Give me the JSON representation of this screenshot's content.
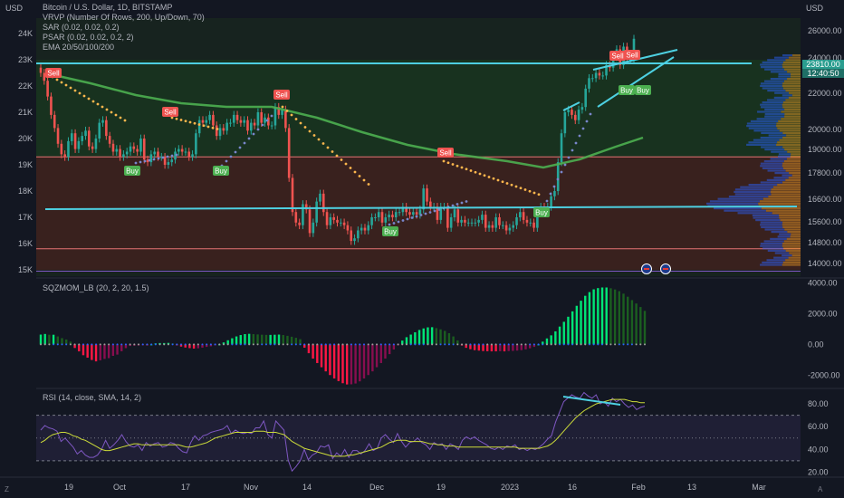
{
  "header": {
    "currency": "USD",
    "title": "Bitcoin / U.S. Dollar, 1D, BITSTAMP",
    "indicators": [
      "VRVP (Number Of Rows, 200, Up/Down, 70)",
      "SAR (0.02, 0.02, 0.2)",
      "PSAR (0.02, 0.02, 0.2, 2)",
      "EMA 20/50/100/200"
    ],
    "price_badge": "23810.00",
    "countdown": "12:40:50",
    "timezone_icon": "Z",
    "settings_icon": "A"
  },
  "colors": {
    "background": "#131722",
    "cyan_line": "#4dd0e1",
    "red_zone": "#b71c1c",
    "green_zone": "#1b5e20",
    "up": "#26a69a",
    "down": "#ef5350",
    "ema": "#4caf50",
    "sar_red": "#ffb74d",
    "sar_blue": "#7986cb",
    "sell_badge": "#ef5350",
    "buy_badge": "#4caf50",
    "rsi": "#7e57c2",
    "rsi_sma": "#cddc39"
  },
  "chart_data": [
    {
      "type": "candlestick",
      "title": "Bitcoin / U.S. Dollar, 1D, BITSTAMP",
      "ylabel_left": "USD",
      "yticks_left": [
        "24K",
        "23K",
        "22K",
        "21K",
        "20K",
        "19K",
        "18K",
        "17K",
        "16K",
        "15K"
      ],
      "yticks_right": [
        "26000.00",
        "24000.00",
        "22000.00",
        "20000.00",
        "19000.00",
        "17800.00",
        "16600.00",
        "15600.00",
        "14800.00",
        "14000.00"
      ],
      "xticks": [
        "19",
        "Oct",
        "17",
        "Nov",
        "14",
        "Dec",
        "19",
        "2023",
        "16",
        "Feb",
        "13",
        "Mar"
      ],
      "close_series": [
        22500,
        22200,
        21600,
        20900,
        20400,
        19800,
        19400,
        19300,
        19900,
        20200,
        19600,
        19900,
        20100,
        20300,
        19700,
        19600,
        20000,
        20600,
        20700,
        20100,
        19800,
        19500,
        19600,
        19300,
        19400,
        19500,
        19700,
        19600,
        19500,
        20000,
        19200,
        19100,
        19400,
        19500,
        19300,
        19300,
        19000,
        19100,
        19200,
        19500,
        19600,
        19500,
        19500,
        19300,
        19400,
        20200,
        20700,
        20600,
        20700,
        20900,
        20500,
        20100,
        20400,
        20300,
        20600,
        20600,
        20900,
        20700,
        20600,
        20700,
        20300,
        20600,
        20500,
        21000,
        20600,
        20800,
        20500,
        20500,
        21200,
        20900,
        21100,
        20400,
        18500,
        17200,
        16800,
        16700,
        17500,
        17300,
        16400,
        16800,
        17600,
        17900,
        17200,
        16700,
        17000,
        16900,
        16800,
        16800,
        16700,
        16500,
        16100,
        16200,
        16500,
        16600,
        16500,
        16700,
        17000,
        17000,
        17200,
        16800,
        17000,
        17100,
        17000,
        17200,
        17200,
        17400,
        17200,
        17100,
        17200,
        17100,
        17300,
        18100,
        17600,
        17400,
        17400,
        16900,
        17400,
        17400,
        16600,
        17000,
        17300,
        16800,
        16900,
        16800,
        16800,
        16800,
        16800,
        16900,
        17100,
        16600,
        16700,
        16600,
        17000,
        16700,
        16700,
        16500,
        16600,
        16700,
        17000,
        17200,
        16900,
        16800,
        16800,
        16600,
        17200,
        17400,
        17300,
        17400,
        17800,
        18000,
        19100,
        20200,
        21000,
        21100,
        20900,
        20700,
        21100,
        21200,
        21900,
        22300,
        22300,
        22500,
        22400,
        22400,
        22800,
        22700,
        23100,
        23400,
        22800,
        23500,
        23000,
        23000,
        23800
      ]
    },
    {
      "type": "bar",
      "title": "SQZMOM_LB (20, 2, 20, 1.5)",
      "yticks": [
        "4000.00",
        "2000.00",
        "0.00",
        "-2000.00"
      ],
      "values": [
        640,
        680,
        630,
        630,
        520,
        410,
        320,
        180,
        -230,
        -450,
        -700,
        -860,
        -1010,
        -1100,
        -1030,
        -940,
        -890,
        -740,
        -660,
        -440,
        -240,
        -100,
        -80,
        -70,
        -40,
        -50,
        0,
        70,
        90,
        90,
        100,
        70,
        -50,
        -140,
        -200,
        -240,
        -270,
        -250,
        -210,
        -160,
        -120,
        -60,
        0,
        130,
        270,
        400,
        520,
        610,
        670,
        690,
        670,
        650,
        630,
        620,
        620,
        630,
        640,
        610,
        560,
        500,
        430,
        340,
        -210,
        -570,
        -920,
        -1210,
        -1480,
        -1750,
        -1990,
        -2210,
        -2380,
        -2520,
        -2600,
        -2590,
        -2540,
        -2400,
        -2210,
        -1990,
        -1750,
        -1480,
        -1210,
        -920,
        -630,
        -330,
        -30,
        250,
        470,
        640,
        790,
        940,
        1040,
        1110,
        1120,
        1060,
        980,
        880,
        730,
        520,
        260,
        -70,
        -220,
        -310,
        -370,
        -400,
        -430,
        -440,
        -450,
        -450,
        -440,
        -450,
        -430,
        -420,
        -400,
        -370,
        -320,
        -250,
        -160,
        0,
        180,
        390,
        590,
        850,
        1160,
        1470,
        1800,
        2150,
        2510,
        2840,
        3160,
        3400,
        3580,
        3660,
        3700,
        3700,
        3650,
        3570,
        3460,
        3300,
        3100,
        2880,
        2660,
        2430,
        2180
      ],
      "ylim": [
        -2800,
        4200
      ]
    },
    {
      "type": "line",
      "title": "RSI (14, close, SMA, 14, 2)",
      "yticks": [
        "80.00",
        "60.00",
        "40.00",
        "20.00"
      ],
      "series": [
        {
          "name": "RSI",
          "values": [
            57,
            61,
            59,
            58,
            56,
            47,
            50,
            46,
            42,
            36,
            39,
            35,
            33,
            33,
            35,
            40,
            48,
            41,
            44,
            48,
            53,
            47,
            43,
            42,
            44,
            39,
            46,
            43,
            45,
            46,
            42,
            43,
            46,
            45,
            41,
            38,
            37,
            46,
            52,
            48,
            52,
            53,
            55,
            56,
            57,
            58,
            61,
            54,
            57,
            55,
            54,
            55,
            54,
            59,
            59,
            65,
            53,
            50,
            65,
            61,
            57,
            31,
            21,
            25,
            30,
            40,
            31,
            35,
            37,
            43,
            42,
            44,
            32,
            37,
            34,
            40,
            33,
            39,
            39,
            36,
            39,
            45,
            39,
            41,
            50,
            53,
            49,
            46,
            54,
            47,
            42,
            46,
            47,
            50,
            46,
            44,
            40,
            46,
            44,
            45,
            40,
            45,
            43,
            40,
            48,
            51,
            49,
            51,
            48,
            46,
            44,
            41,
            40,
            42,
            40,
            43,
            42,
            44,
            40,
            41,
            39,
            41,
            40,
            42,
            45,
            49,
            52,
            64,
            73,
            82,
            85,
            88,
            86,
            85,
            90,
            87,
            85,
            88,
            80,
            82,
            78,
            85,
            82,
            84,
            80,
            77,
            79,
            75,
            77,
            78
          ]
        },
        {
          "name": "SMA",
          "values": [
            46,
            48,
            51,
            53,
            54,
            55,
            55,
            54,
            52,
            51,
            49,
            48,
            46,
            44,
            42,
            40,
            39,
            39,
            40,
            41,
            42,
            43,
            44,
            45,
            45,
            44,
            44,
            44,
            44,
            44,
            44,
            44,
            44,
            44,
            44,
            43,
            42,
            42,
            43,
            44,
            45,
            46,
            48,
            50,
            51,
            52,
            53,
            54,
            55,
            55,
            55,
            55,
            55,
            56,
            56,
            56,
            55,
            55,
            55,
            54,
            53,
            50,
            47,
            45,
            43,
            41,
            40,
            39,
            38,
            37,
            36,
            35,
            34,
            34,
            34,
            34,
            35,
            35,
            36,
            37,
            38,
            39,
            40,
            41,
            42,
            44,
            46,
            47,
            48,
            48,
            48,
            47,
            47,
            47,
            47,
            46,
            45,
            45,
            44,
            44,
            43,
            43,
            43,
            42,
            42,
            42,
            42,
            42,
            42,
            42,
            42,
            42,
            42,
            42,
            42,
            42,
            42,
            42,
            41,
            41,
            41,
            41,
            41,
            41,
            42,
            43,
            45,
            48,
            52,
            56,
            60,
            64,
            68,
            71,
            74,
            76,
            78,
            80,
            81,
            82,
            83,
            84,
            84,
            84,
            84,
            83,
            82,
            82,
            81,
            81
          ]
        }
      ],
      "ylim": [
        18,
        92
      ],
      "levels": [
        70,
        30
      ]
    }
  ],
  "signals": {
    "sell": [
      {
        "label": "Sell"
      },
      {
        "label": "Sell"
      },
      {
        "label": "Sell"
      },
      {
        "label": "Sell"
      },
      {
        "label": "Sell"
      },
      {
        "label": "Sell"
      }
    ],
    "buy": [
      {
        "label": "Buy"
      },
      {
        "label": "Buy"
      },
      {
        "label": "Buy"
      },
      {
        "label": "Buy"
      },
      {
        "label": "Buy"
      },
      {
        "label": "Buy"
      }
    ]
  }
}
